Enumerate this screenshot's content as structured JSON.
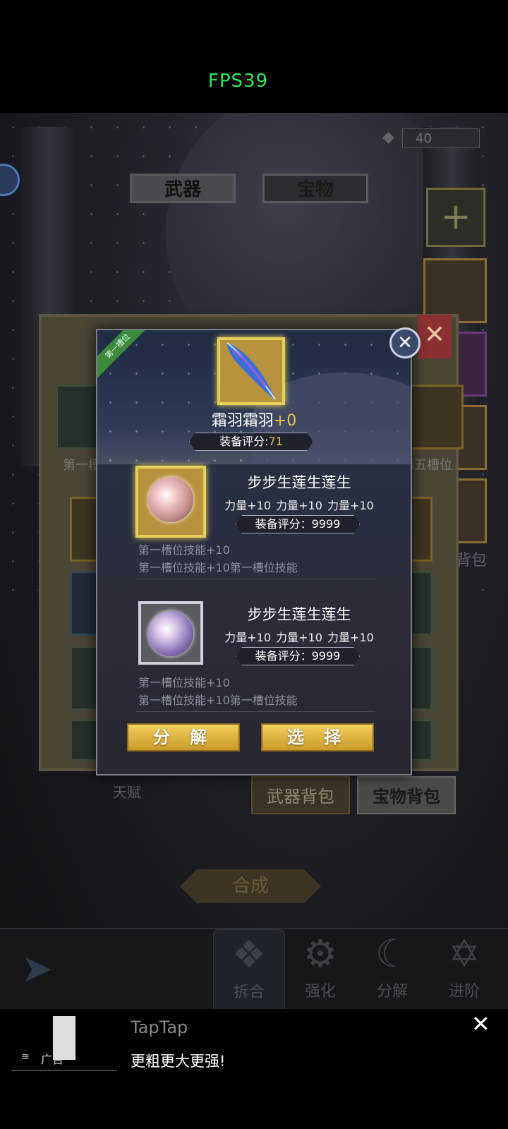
{
  "status": {
    "fps": "FPS39"
  },
  "game": {
    "crystal_count": "40",
    "tabs": [
      "武器",
      "宝物"
    ],
    "slot_labels": [
      "第一槽位",
      "第五槽位"
    ],
    "side_label": "背包",
    "bottom_tabs": {
      "talent": "天赋",
      "weapon_bag": "武器背包",
      "treasure_bag": "宝物背包"
    },
    "compose_button": "合成",
    "nav": [
      "拆合",
      "强化",
      "分解",
      "进阶"
    ]
  },
  "modal": {
    "ribbon": "第一槽位",
    "item_name": "霜羽霜羽",
    "item_plus": "+0",
    "item_score_label": "装备评分:",
    "item_score_value": "71",
    "gems": [
      {
        "name": "步步生莲生莲生",
        "stats": "力量+10  力量+10  力量+10",
        "score": "装备评分：9999",
        "skill1": "第一槽位技能+10",
        "skill2": "第一槽位技能+10第一槽位技能"
      },
      {
        "name": "步步生莲生莲生",
        "stats": "力量+10  力量+10  力量+10",
        "score": "装备评分：9999",
        "skill1": "第一槽位技能+10",
        "skill2": "第一槽位技能+10第一槽位技能"
      }
    ],
    "buttons": {
      "decompose": "分 解",
      "select": "选 择"
    }
  },
  "ad": {
    "badge": "广告",
    "title": "TapTap",
    "text": "更粗更大更强!"
  }
}
